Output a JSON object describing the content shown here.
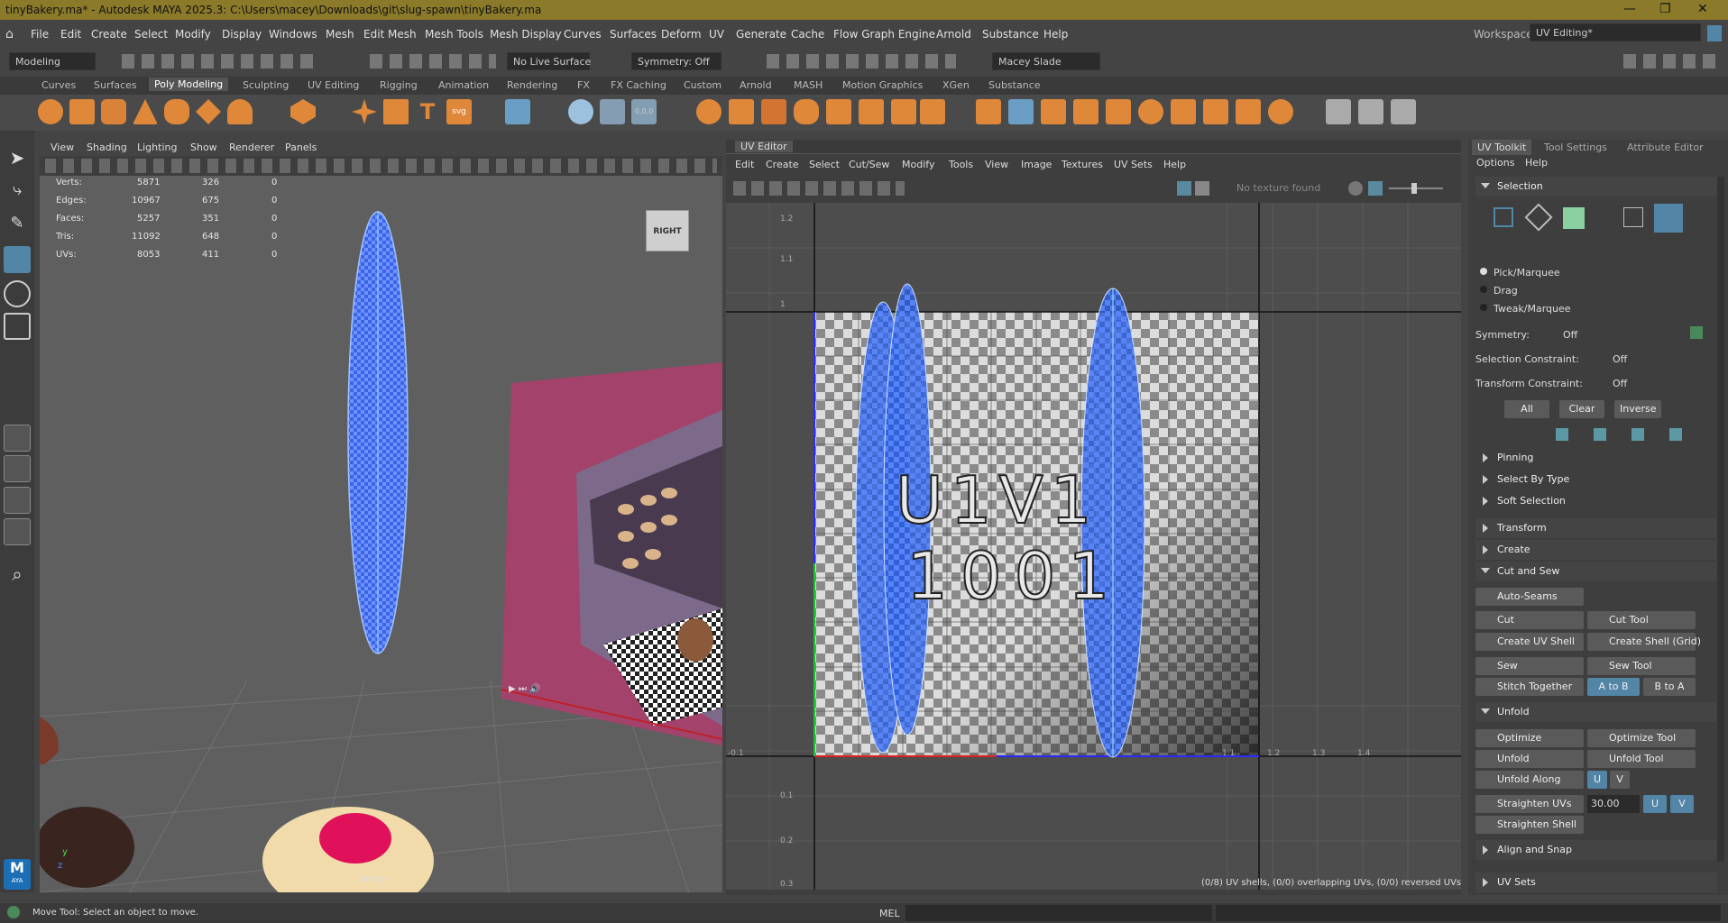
{
  "title": "tinyBakery.ma* - Autodesk MAYA 2025.3: C:\\Users\\macey\\Downloads\\git\\slug-spawn\\tinyBakery.ma",
  "menu": [
    "File",
    "Edit",
    "Create",
    "Select",
    "Modify",
    "Display",
    "Windows",
    "Mesh",
    "Edit Mesh",
    "Mesh Tools",
    "Mesh Display",
    "Curves",
    "Surfaces",
    "Deform",
    "UV",
    "Generate",
    "Cache",
    "Flow Graph Engine",
    "Arnold",
    "Substance",
    "Help"
  ],
  "workspace": {
    "label": "Workspace:",
    "value": "UV Editing*"
  },
  "statusline": {
    "mode": "Modeling",
    "live": "No Live Surface",
    "symmetry": "Symmetry: Off",
    "user": "Macey Slade"
  },
  "shelf_tabs": [
    "Curves",
    "Surfaces",
    "Poly Modeling",
    "Sculpting",
    "UV Editing",
    "Rigging",
    "Animation",
    "Rendering",
    "FX",
    "FX Caching",
    "Custom",
    "Arnold",
    "MASH",
    "Motion Graphics",
    "XGen",
    "Substance"
  ],
  "shelf_active": "Poly Modeling",
  "viewport": {
    "menu": [
      "View",
      "Shading",
      "Lighting",
      "Show",
      "Renderer",
      "Panels"
    ],
    "stats": [
      {
        "label": "Verts:",
        "a": "5871",
        "b": "326",
        "c": "0"
      },
      {
        "label": "Edges:",
        "a": "10967",
        "b": "675",
        "c": "0"
      },
      {
        "label": "Faces:",
        "a": "5257",
        "b": "351",
        "c": "0"
      },
      {
        "label": "Tris:",
        "a": "11092",
        "b": "648",
        "c": "0"
      },
      {
        "label": "UVs:",
        "a": "8053",
        "b": "411",
        "c": "0"
      }
    ],
    "viewcube": "RIGHT",
    "camera": "persp",
    "axis_y": "y",
    "axis_z": "z",
    "logo": "M",
    "logo_sub": "AYA"
  },
  "uv_editor": {
    "title": "UV Editor",
    "menu": [
      "Edit",
      "Create",
      "Select",
      "Cut/Sew",
      "Modify",
      "Tools",
      "View",
      "Image",
      "Textures",
      "UV Sets",
      "Help"
    ],
    "texture": "No texture found",
    "tile_label_1": "U1V1",
    "tile_label_2": "1001",
    "v_ticks": [
      "1.2",
      "1.1",
      "1",
      "0.1",
      "0.2",
      "0.3"
    ],
    "u_ticks": [
      "-0.1",
      "1.1",
      "1.2",
      "1.3",
      "1.4"
    ],
    "status": "(0/8) UV shells, (0/0) overlapping UVs, (0/0) reversed UVs"
  },
  "toolkit": {
    "tabs": [
      "UV Toolkit",
      "Tool Settings",
      "Attribute Editor"
    ],
    "menu": [
      "Options",
      "Help"
    ],
    "selection_header": "Selection",
    "radio": [
      "Pick/Marquee",
      "Drag",
      "Tweak/Marquee"
    ],
    "symmetry_label": "Symmetry:",
    "symmetry_value": "Off",
    "sel_constraint_label": "Selection Constraint:",
    "sel_constraint_value": "Off",
    "trans_constraint_label": "Transform Constraint:",
    "trans_constraint_value": "Off",
    "sel_buttons": [
      "All",
      "Clear",
      "Inverse"
    ],
    "sub_sections": [
      "Pinning",
      "Select By Type",
      "Soft Selection"
    ],
    "sections": [
      "Transform",
      "Create"
    ],
    "cut_sew": "Cut and Sew",
    "auto_seams": "Auto-Seams",
    "cut": "Cut",
    "cut_tool": "Cut Tool",
    "create_uv_shell": "Create UV Shell",
    "create_shell_grid": "Create Shell (Grid)",
    "sew": "Sew",
    "sew_tool": "Sew Tool",
    "stitch": "Stitch Together",
    "a_to_b": "A to B",
    "b_to_a": "B to A",
    "unfold_header": "Unfold",
    "optimize": "Optimize",
    "optimize_tool": "Optimize Tool",
    "unfold": "Unfold",
    "unfold_tool": "Unfold Tool",
    "unfold_along": "Unfold Along",
    "u": "U",
    "v": "V",
    "straighten_uvs": "Straighten UVs",
    "straighten_value": "30.00",
    "straighten_shell": "Straighten Shell",
    "align_snap": "Align and Snap",
    "uv_sets": "UV Sets"
  },
  "bottom": {
    "help": "Move Tool: Select an object to move.",
    "mel": "MEL"
  },
  "colors": {
    "title_bar": "#8a7a2a",
    "accent": "#5285a6",
    "shelf_icon": "#e0883a",
    "uv_shell": "#2f5fd8"
  }
}
